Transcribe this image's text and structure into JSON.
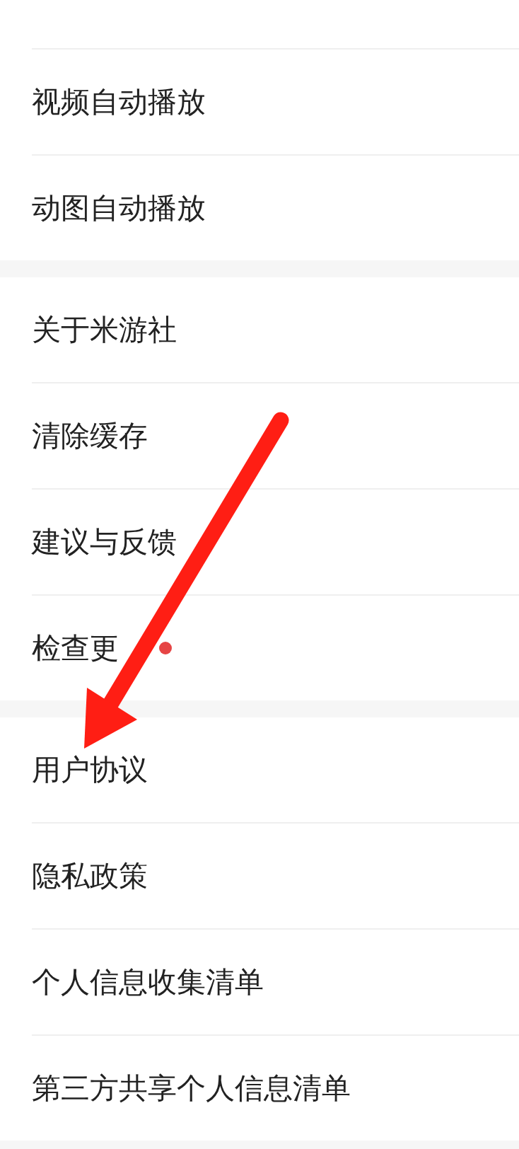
{
  "sections": [
    {
      "items": [
        {
          "label": "视频自动播放",
          "badge_dot": false
        },
        {
          "label": "动图自动播放",
          "badge_dot": false
        }
      ]
    },
    {
      "items": [
        {
          "label": "关于米游社",
          "badge_dot": false
        },
        {
          "label": "清除缓存",
          "badge_dot": false
        },
        {
          "label": "建议与反馈",
          "badge_dot": false
        },
        {
          "label": "检查更",
          "badge_dot": true
        }
      ]
    },
    {
      "items": [
        {
          "label": "用户协议",
          "badge_dot": false
        },
        {
          "label": "隐私政策",
          "badge_dot": false
        },
        {
          "label": "个人信息收集清单",
          "badge_dot": false
        },
        {
          "label": "第三方共享个人信息清单",
          "badge_dot": false
        }
      ]
    }
  ],
  "annotation": {
    "kind": "arrow"
  }
}
